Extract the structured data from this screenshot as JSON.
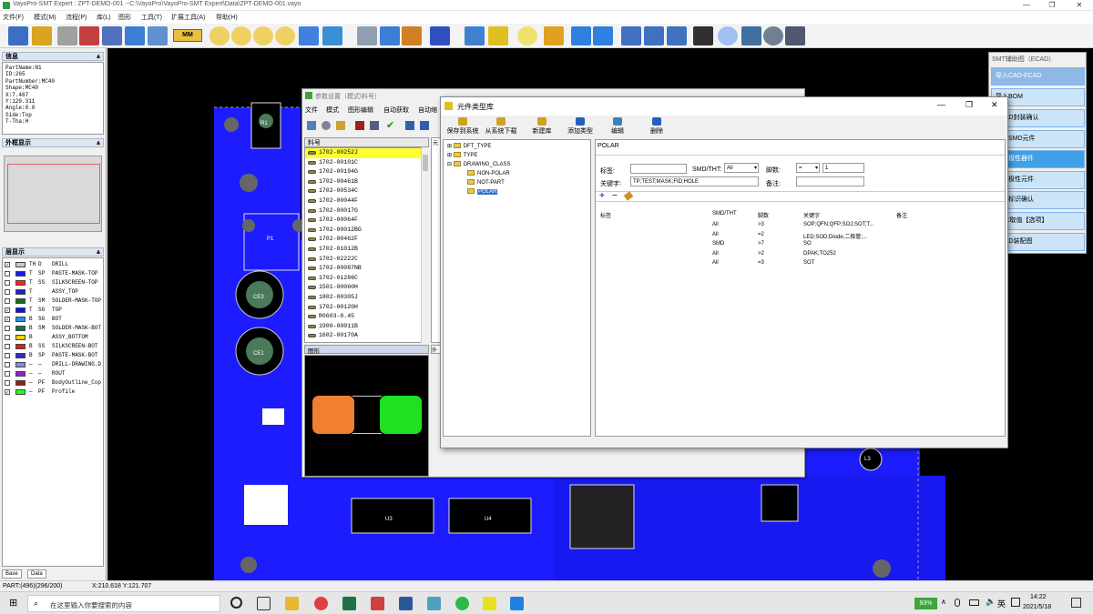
{
  "app": {
    "title": "VayoPro-SMT Expert : ZPT-DEMO-001  --C:\\VayoPro\\VayoPro-SMT Expert\\Data\\ZPT-DEMO-001.vayo"
  },
  "window_buttons": {
    "minimize": "—",
    "maximize": "❐",
    "close": "✕"
  },
  "menu": [
    "文件(F)",
    "模式(M)",
    "流程(P)",
    "库(L)",
    "图形",
    "工具(T)",
    "扩展工具(A)",
    "帮助(H)"
  ],
  "toolbar": {
    "mm_label": "MM"
  },
  "left_panel": {
    "info_title": "信息",
    "info_lines": [
      "PartName:N1",
      "ID:265",
      "PartNumber:MC40",
      "Shape:MC40",
      "X:7.467",
      "Y:129.311",
      "Angle:0.0",
      "Side:Top",
      "T-Tha:H"
    ],
    "thumb_title": "外框显示",
    "layers_title": "层显示",
    "layers": [
      {
        "checked": true,
        "color": "#c8c8c8",
        "a": "TH",
        "b": "D",
        "name": "DRILL"
      },
      {
        "checked": false,
        "color": "#1a1aff",
        "a": "T",
        "b": "SP",
        "name": "PASTE-MASK-TOP"
      },
      {
        "checked": false,
        "color": "#ff2020",
        "a": "T",
        "b": "SS",
        "name": "SILKSCREEN-TOP"
      },
      {
        "checked": false,
        "color": "#2020d0",
        "a": "T",
        "b": "",
        "name": "ASSY_TOP"
      },
      {
        "checked": false,
        "color": "#107010",
        "a": "T",
        "b": "SM",
        "name": "SOLDER-MASK-TOP"
      },
      {
        "checked": true,
        "color": "#1010ff",
        "a": "T",
        "b": "SG",
        "name": "TOP"
      },
      {
        "checked": true,
        "color": "#2090ff",
        "a": "B",
        "b": "SG",
        "name": "BOT"
      },
      {
        "checked": false,
        "color": "#107050",
        "a": "B",
        "b": "SM",
        "name": "SOLDER-MASK-BOT"
      },
      {
        "checked": false,
        "color": "#ffd000",
        "a": "B",
        "b": "",
        "name": "ASSY_BOTTOM"
      },
      {
        "checked": false,
        "color": "#e02020",
        "a": "B",
        "b": "SS",
        "name": "SILKSCREEN-BOT"
      },
      {
        "checked": false,
        "color": "#3030c0",
        "a": "B",
        "b": "SP",
        "name": "PASTE-MASK-BOT"
      },
      {
        "checked": false,
        "color": "#8090d0",
        "a": "—",
        "b": "—",
        "name": "DRILL-DRAWING.D"
      },
      {
        "checked": false,
        "color": "#9020d0",
        "a": "—",
        "b": "—",
        "name": "ROUT"
      },
      {
        "checked": false,
        "color": "#902020",
        "a": "—",
        "b": "PF",
        "name": "BodyOutline_Cop"
      },
      {
        "checked": true,
        "color": "#20ff20",
        "a": "—",
        "b": "PF",
        "name": "Profile"
      }
    ],
    "tabs": [
      "Base",
      "Data"
    ]
  },
  "right_panel": {
    "title": "SMT辅助图（ECAD）",
    "buttons": [
      "导入CAD-ECAD",
      "导入BOM",
      "ECAD封装确认",
      "选择SMD元件",
      "选择极性器件",
      "选择极性元件",
      "极性标识确认",
      "PL/C取值【选项】",
      "ECAD装配图"
    ]
  },
  "param_window": {
    "title": "参数设置（模式\\料号）",
    "menu": [
      "文件",
      "模式",
      "图形编辑",
      "自动获取",
      "自动缩"
    ],
    "list_header": "料号",
    "parts": [
      "1702-00252J",
      "1702-00101C",
      "1702-00194G",
      "1702-00461B",
      "1702-00534C",
      "1702-00044F",
      "1702-00017G",
      "1702-00064F",
      "1702-00012BG",
      "1702-00462F",
      "1702-01012B",
      "1702-02222C",
      "1702-00087NB",
      "1702-01286C",
      "1501-00060H",
      "1802-00305J",
      "1702-00120H",
      "R0603-0.45",
      "1900-00011B",
      "1602-00170A"
    ],
    "preview_label": "图形",
    "side_col_1": "元",
    "side_col_2": "外"
  },
  "lib_window": {
    "title": "元件类型库",
    "toolbar": [
      "保存到系统",
      "从系统下载",
      "新建库",
      "添加类型",
      "编辑",
      "删除"
    ],
    "tree": [
      "DFT_TYPE",
      "TYPE",
      "DRAWING_CLASS",
      "NON-POLAR",
      "NOT-PART",
      "POLAR"
    ],
    "selected": "POLAR",
    "detail_title": "POLAR",
    "form": {
      "tag_label": "标签:",
      "smd_label": "SMD/THT:",
      "smd_value": "All",
      "pin_label": "脚数:",
      "pin_op": "=",
      "pin_value": "1",
      "kw_label": "关键字:",
      "kw_value": "TP;TEST;MASK;FID;HOLE",
      "note_label": "备注:"
    },
    "columns": [
      "标签",
      "SMD/THT",
      "脚数",
      "关键字",
      "备注"
    ],
    "rows": [
      {
        "tag": "",
        "smd": "All",
        "pins": ">3",
        "kw": "SOP;QFN;QFP;SOJ;SOT;T...",
        "note": ""
      },
      {
        "tag": "",
        "smd": "All",
        "pins": "=2",
        "kw": "LED;SOD;Diode;二极管;...",
        "note": ""
      },
      {
        "tag": "",
        "smd": "SMD",
        "pins": ">7",
        "kw": "SO",
        "note": ""
      },
      {
        "tag": "",
        "smd": "All",
        "pins": ">2",
        "kw": "DPAK;TO252",
        "note": ""
      },
      {
        "tag": "",
        "smd": "All",
        "pins": "=3",
        "kw": "SOT",
        "note": ""
      }
    ]
  },
  "canvas_labels": {
    "u3": "U3",
    "u4": "U4",
    "ce3": "CE3",
    "ce1": "CE1",
    "l3": "L3",
    "r1": "R1",
    "p1": "P1"
  },
  "status": {
    "part": "PART:(496)(296/200)",
    "coord": "X:210.618 Y:121.707"
  },
  "taskbar": {
    "search_placeholder": "在这里输入你要搜索的内容",
    "battery": "93%",
    "ime": "英",
    "time": "14:22",
    "date": "2021/5/18"
  }
}
